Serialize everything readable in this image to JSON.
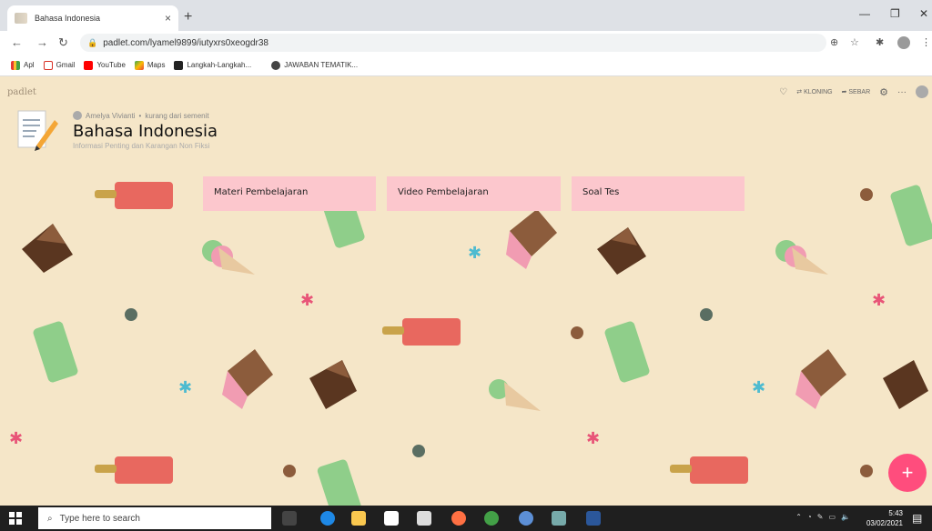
{
  "browser": {
    "tab_title": "Bahasa Indonesia",
    "url": "padlet.com/lyamel9899/iutyxrs0xeogdr38",
    "bookmarks": [
      "Apl",
      "Gmail",
      "YouTube",
      "Maps",
      "Langkah-Langkah...",
      "JAWABAN TEMATIK..."
    ]
  },
  "padlet": {
    "brand": "padlet",
    "actions": {
      "clone": "KLONING",
      "share": "SEBAR"
    },
    "author": "Amelya Vivianti",
    "time": "kurang dari semenit",
    "title": "Bahasa Indonesia",
    "subtitle": "Informasi Penting dan Karangan Non Fiksi",
    "columns": [
      "Materi Pembelajaran",
      "Video Pembelajaran",
      "Soal Tes"
    ]
  },
  "taskbar": {
    "search_placeholder": "Type here to search",
    "time": "5:43",
    "date": "03/02/2021"
  },
  "colors": {
    "background": "#f5e6c8",
    "column": "#fcc7cd",
    "fab": "#ff4d7d"
  }
}
